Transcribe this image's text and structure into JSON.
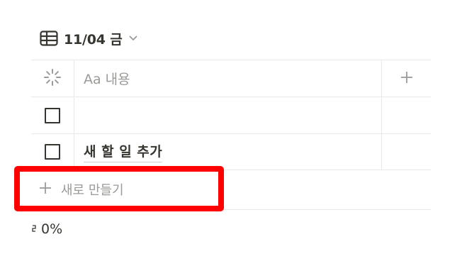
{
  "view": {
    "title": "11/04 금",
    "icon": "table-icon"
  },
  "table": {
    "header": {
      "status_icon": "loading-icon",
      "name_label": "Aa 내용",
      "add_column_icon": "plus-icon"
    },
    "rows": [
      {
        "checked": false,
        "name": ""
      },
      {
        "checked": false,
        "name": "새 할 일 추가"
      }
    ]
  },
  "add_row": {
    "label": "새로 만들기",
    "icon": "plus-icon"
  },
  "footer": {
    "progress_text": "0%",
    "progress_value": 0
  },
  "colors": {
    "text": "#37352f",
    "muted": "#9b9a97",
    "border": "#e9e9e7",
    "highlight": "#ff0000"
  }
}
